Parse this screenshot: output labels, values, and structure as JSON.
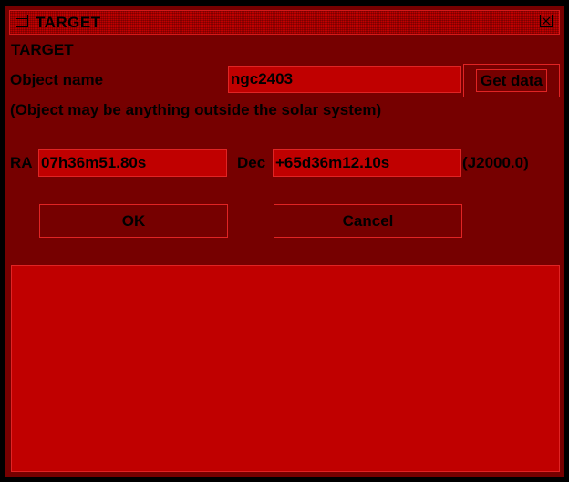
{
  "window": {
    "title": "TARGET"
  },
  "dialog": {
    "heading": "TARGET",
    "object_name_label": "Object name",
    "object_name_value": "ngc2403",
    "get_data_label": "Get data",
    "hint": "(Object may be anything outside the solar system)",
    "ra_label": "RA",
    "ra_value": "07h36m51.80s",
    "dec_label": "Dec",
    "dec_value": "+65d36m12.10s",
    "epoch": "(J2000.0)",
    "ok_label": "OK",
    "cancel_label": "Cancel"
  },
  "output": {
    "text": ""
  },
  "icons": {
    "window_menu": "window-icon",
    "close": "close-icon"
  },
  "colors": {
    "background": "#760000",
    "field": "#c00000",
    "border": "#e02424",
    "text": "#000000"
  }
}
